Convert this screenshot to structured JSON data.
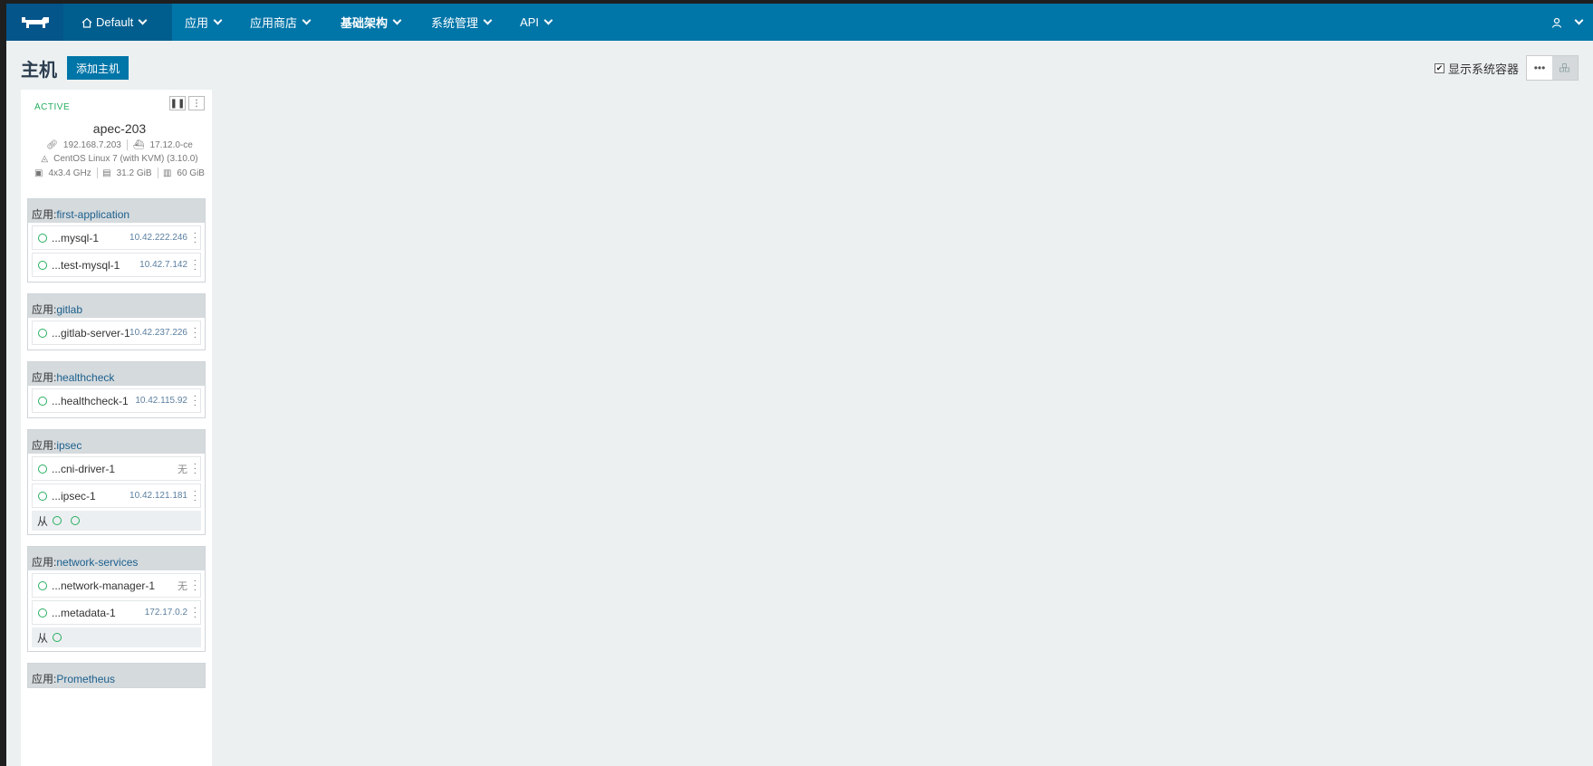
{
  "nav": {
    "logo_icon": "rancher-cow-icon",
    "environment": "Default",
    "items": [
      {
        "label": "应用",
        "active": false
      },
      {
        "label": "应用商店",
        "active": false
      },
      {
        "label": "基础架构",
        "active": true
      },
      {
        "label": "系统管理",
        "active": false
      },
      {
        "label": "API",
        "active": false
      }
    ],
    "user_icon": "user-icon"
  },
  "header": {
    "title": "主机",
    "add_button": "添加主机",
    "show_system_label": "显示系统容器",
    "show_system_checked": true
  },
  "host": {
    "state": "ACTIVE",
    "name": "apec-203",
    "ip": "192.168.7.203",
    "docker_version": "17.12.0-ce",
    "os": "CentOS Linux 7 (with KVM) (3.10.0)",
    "cpu": "4x3.4 GHz",
    "memory": "31.2 GiB",
    "storage": "60 GiB"
  },
  "stack_prefix": "应用:",
  "sidekick_label": "从",
  "stacks": [
    {
      "name": "first-application",
      "containers": [
        {
          "name": "...mysql-1",
          "ip": "10.42.222.246"
        },
        {
          "name": "...test-mysql-1",
          "ip": "10.42.7.142"
        }
      ]
    },
    {
      "name": "gitlab",
      "containers": [
        {
          "name": "...gitlab-server-1",
          "ip": "10.42.237.226"
        }
      ]
    },
    {
      "name": "healthcheck",
      "containers": [
        {
          "name": "...healthcheck-1",
          "ip": "10.42.115.92"
        }
      ]
    },
    {
      "name": "ipsec",
      "containers": [
        {
          "name": "...cni-driver-1",
          "ip": "无"
        },
        {
          "name": "...ipsec-1",
          "ip": "10.42.121.181"
        }
      ],
      "sidekicks": 2
    },
    {
      "name": "network-services",
      "containers": [
        {
          "name": "...network-manager-1",
          "ip": "无"
        },
        {
          "name": "...metadata-1",
          "ip": "172.17.0.2"
        }
      ],
      "sidekicks": 1
    },
    {
      "name": "Prometheus",
      "containers": []
    }
  ]
}
